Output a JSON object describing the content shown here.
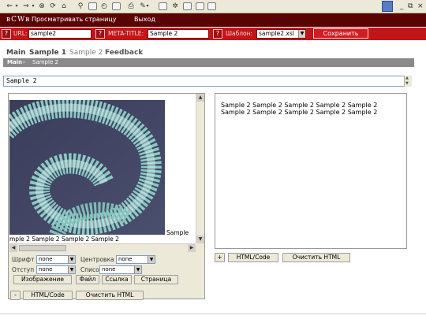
{
  "toolbar": {
    "icons": [
      "back-arrow-icon",
      "forward-arrow-icon",
      "stop-icon",
      "refresh-icon",
      "home-icon",
      "search-icon",
      "favorites-icon",
      "history-icon",
      "mail-icon",
      "print-icon",
      "edit-icon",
      "discuss-icon",
      "messenger-icon"
    ],
    "window_controls": [
      "_",
      "⧉",
      "×"
    ]
  },
  "menu": {
    "logo": "вCWв",
    "items": [
      "Просматривать страницу",
      "Выход"
    ]
  },
  "meta_bar": {
    "help": "?",
    "url_label": "URL:",
    "url_value": "sample2",
    "meta_title_label": "META-TITLE:",
    "meta_title_value": "Sample 2",
    "template_label": "Шаблон:",
    "template_value": "sample2.xsl",
    "save_label": "Сохранить"
  },
  "tabs": [
    "Main",
    "Sample 1",
    "Sample 2",
    "Feedback"
  ],
  "breadcrumb": [
    "Main",
    "›",
    "Sample 2"
  ],
  "page_title": "Sample 2",
  "left_editor": {
    "trailing_text": "Sample",
    "overflow_text": "mple 2 Sample 2 Sample 2 Sample 2",
    "font_label": "Шрифт",
    "font_value": "none",
    "align_label": "Центровка",
    "align_value": "none",
    "indent_label": "Отступ",
    "indent_value": "none",
    "list_label": "Список",
    "list_value": "none",
    "buttons": [
      "Изображение",
      "Файл",
      "Ссылка",
      "Страница"
    ],
    "bottom": {
      "toggle": "-",
      "html_code": "HTML/Code",
      "clear_html": "Очистить HTML"
    }
  },
  "right_editor": {
    "lines": [
      "Sample 2 Sample 2 Sample 2 Sample 2 Sample 2",
      "Sample 2 Sample 2 Sample 2 Sample 2 Sample 2"
    ],
    "toggle": "+",
    "html_code": "HTML/Code",
    "clear_html": "Очистить HTML"
  }
}
